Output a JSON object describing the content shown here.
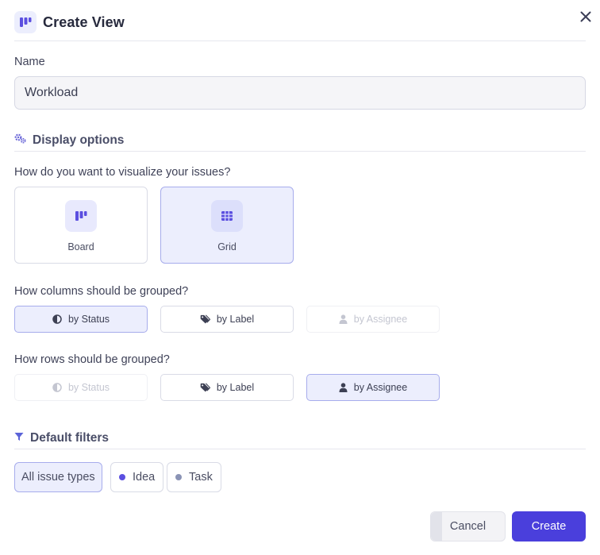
{
  "dialog": {
    "title": "Create View",
    "icon": "board-columns-icon",
    "close_icon": "close-icon"
  },
  "name_field": {
    "label": "Name",
    "value": "Workload"
  },
  "display_options": {
    "heading": "Display options",
    "icon": "gears-icon",
    "visualize_question": "How do you want to visualize your issues?",
    "view_types": [
      {
        "label": "Board",
        "icon": "board-icon",
        "selected": false
      },
      {
        "label": "Grid",
        "icon": "grid-icon",
        "selected": true
      }
    ],
    "columns_question": "How columns should be grouped?",
    "column_groups": [
      {
        "label": "by Status",
        "icon": "status-half-circle-icon",
        "state": "selected"
      },
      {
        "label": "by Label",
        "icon": "tag-icon",
        "state": "normal"
      },
      {
        "label": "by Assignee",
        "icon": "user-icon",
        "state": "disabled"
      }
    ],
    "rows_question": "How rows should be grouped?",
    "row_groups": [
      {
        "label": "by Status",
        "icon": "status-half-circle-icon",
        "state": "disabled"
      },
      {
        "label": "by Label",
        "icon": "tag-icon",
        "state": "normal"
      },
      {
        "label": "by Assignee",
        "icon": "user-icon",
        "state": "selected"
      }
    ]
  },
  "default_filters": {
    "heading": "Default filters",
    "icon": "filter-funnel-icon",
    "chips": [
      {
        "label": "All issue types",
        "selected": true
      },
      {
        "label": "Idea",
        "dot_color": "#5b4fe0"
      },
      {
        "label": "Task",
        "dot_color": "#8a93b5"
      }
    ]
  },
  "footer": {
    "cancel_label": "Cancel",
    "create_label": "Create"
  },
  "colors": {
    "accent": "#4a3fdc",
    "selected_bg": "#eceefd",
    "selected_border": "#a7acec"
  }
}
